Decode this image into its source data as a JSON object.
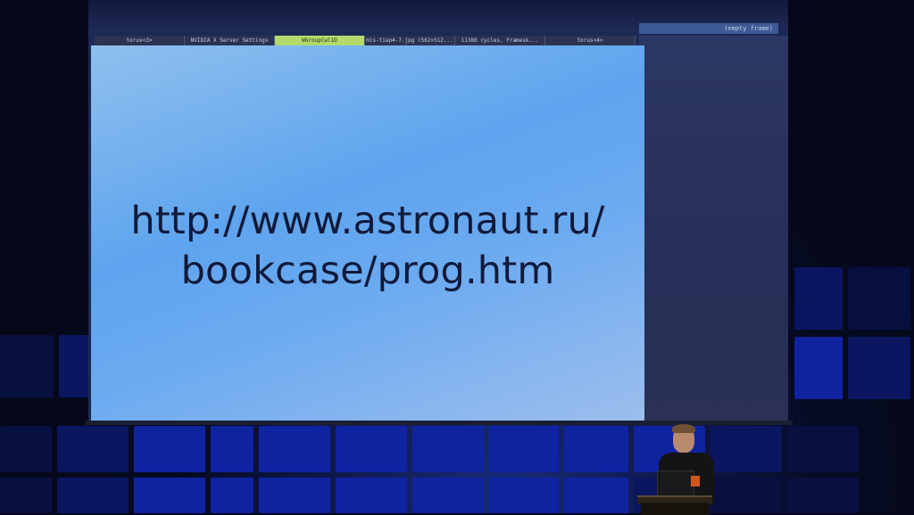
{
  "tabbar": {
    "tabs": [
      {
        "label": "torus<3>",
        "active": false
      },
      {
        "label": "NVIDIA X Server Settings",
        "active": false
      },
      {
        "label": "WGroupCwl1D",
        "active": true
      },
      {
        "label": "mis-tiap4-7.jpg (562×512...",
        "active": false
      },
      {
        "label": "11386 cycles, Framesk...",
        "active": false
      },
      {
        "label": "torus<4>",
        "active": false
      }
    ]
  },
  "right_pane": {
    "frame_label": "(empty frame)"
  },
  "slide": {
    "url_line_1": "http://www.astronaut.ru/",
    "url_line_2": "bookcase/prog.htm"
  },
  "colors": {
    "active_tab": "#b4d96a",
    "slide_background": "#5ea4ee",
    "slide_text": "#111a3a",
    "stage_tiles": "#0f23a0"
  }
}
